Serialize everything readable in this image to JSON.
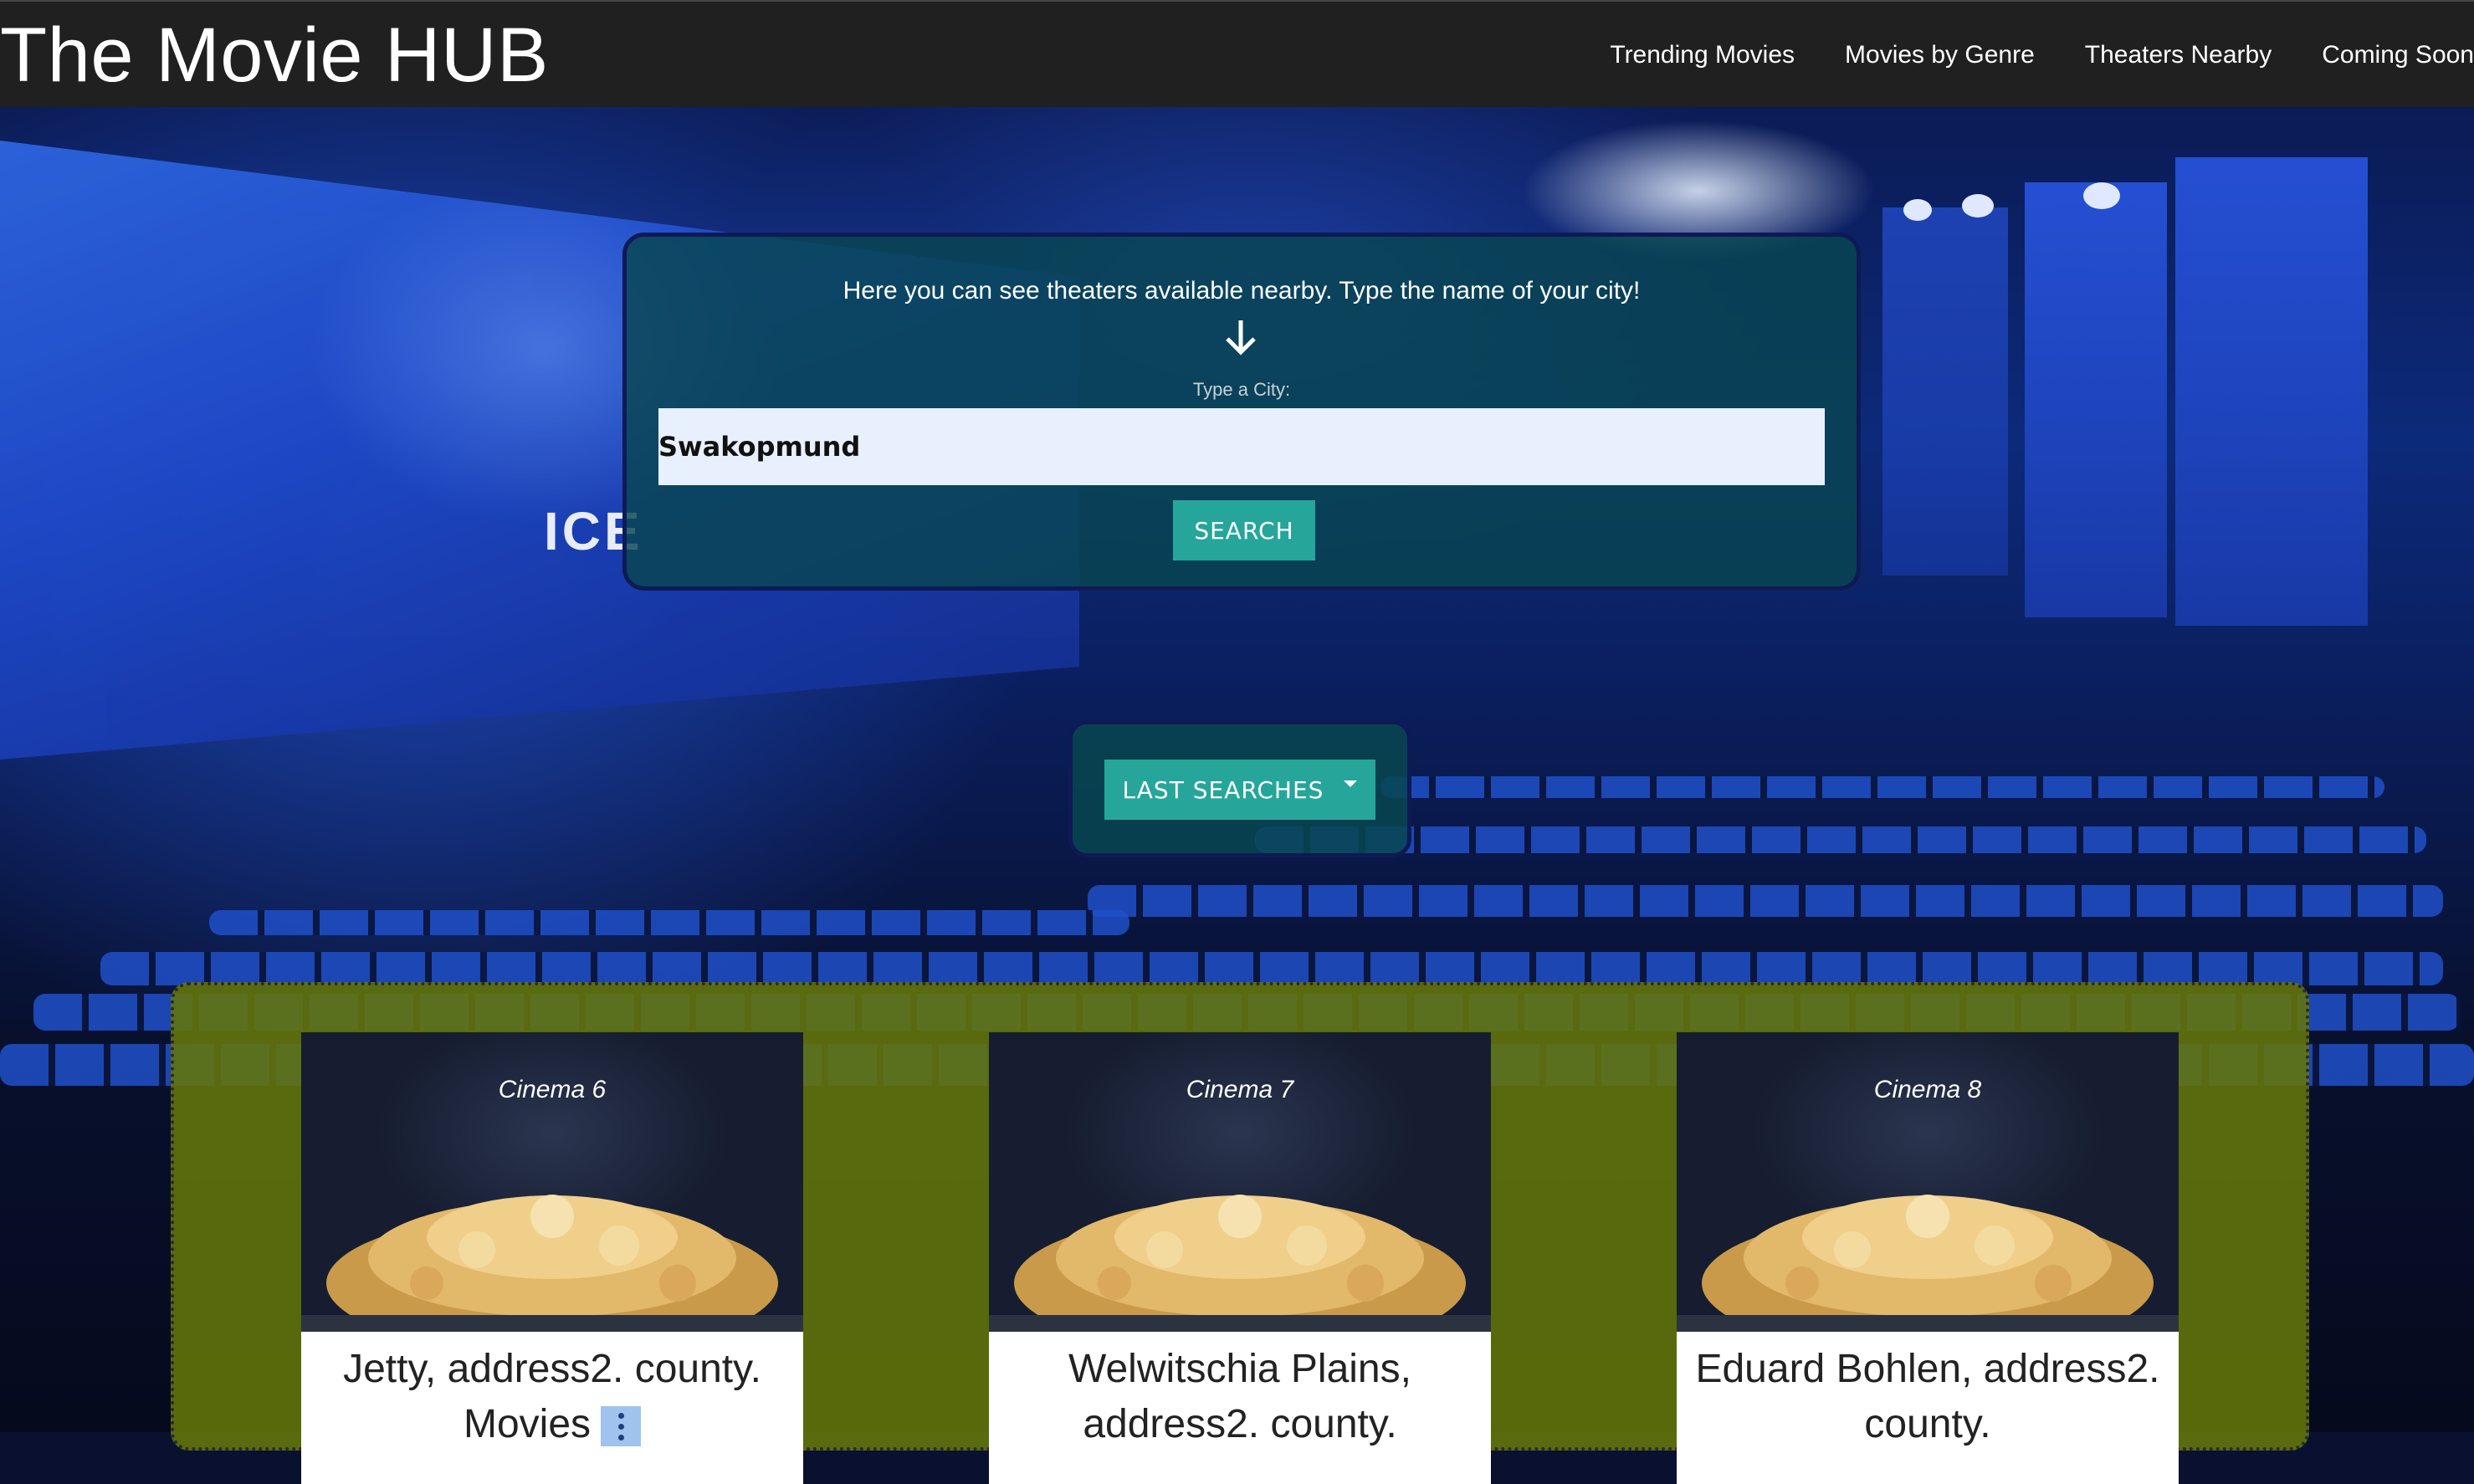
{
  "navbar": {
    "brand": "The Movie HUB",
    "links": [
      "Trending Movies",
      "Movies by Genre",
      "Theaters Nearby",
      "Coming Soon"
    ]
  },
  "search": {
    "instruction": "Here you can see theaters available nearby. Type the name of your city!",
    "label": "Type a City:",
    "value": "Swakopmund",
    "button_label": "SEARCH"
  },
  "last_searches": {
    "button_label": "LAST SEARCHES"
  },
  "results": [
    {
      "title": "Cinema 6",
      "text": "Jetty, address2. county. Movies"
    },
    {
      "title": "Cinema 7",
      "text": "Welwitschia Plains, address2. county."
    },
    {
      "title": "Cinema 8",
      "text": "Eduard Bohlen, address2. county."
    }
  ],
  "colors": {
    "navbar": "#202020",
    "accent": "#26a69a",
    "panel": "#084650",
    "results_bg": "#64760a"
  },
  "icons": [
    "arrow-down-icon",
    "dropdown-caret-icon",
    "more-vert-icon"
  ]
}
